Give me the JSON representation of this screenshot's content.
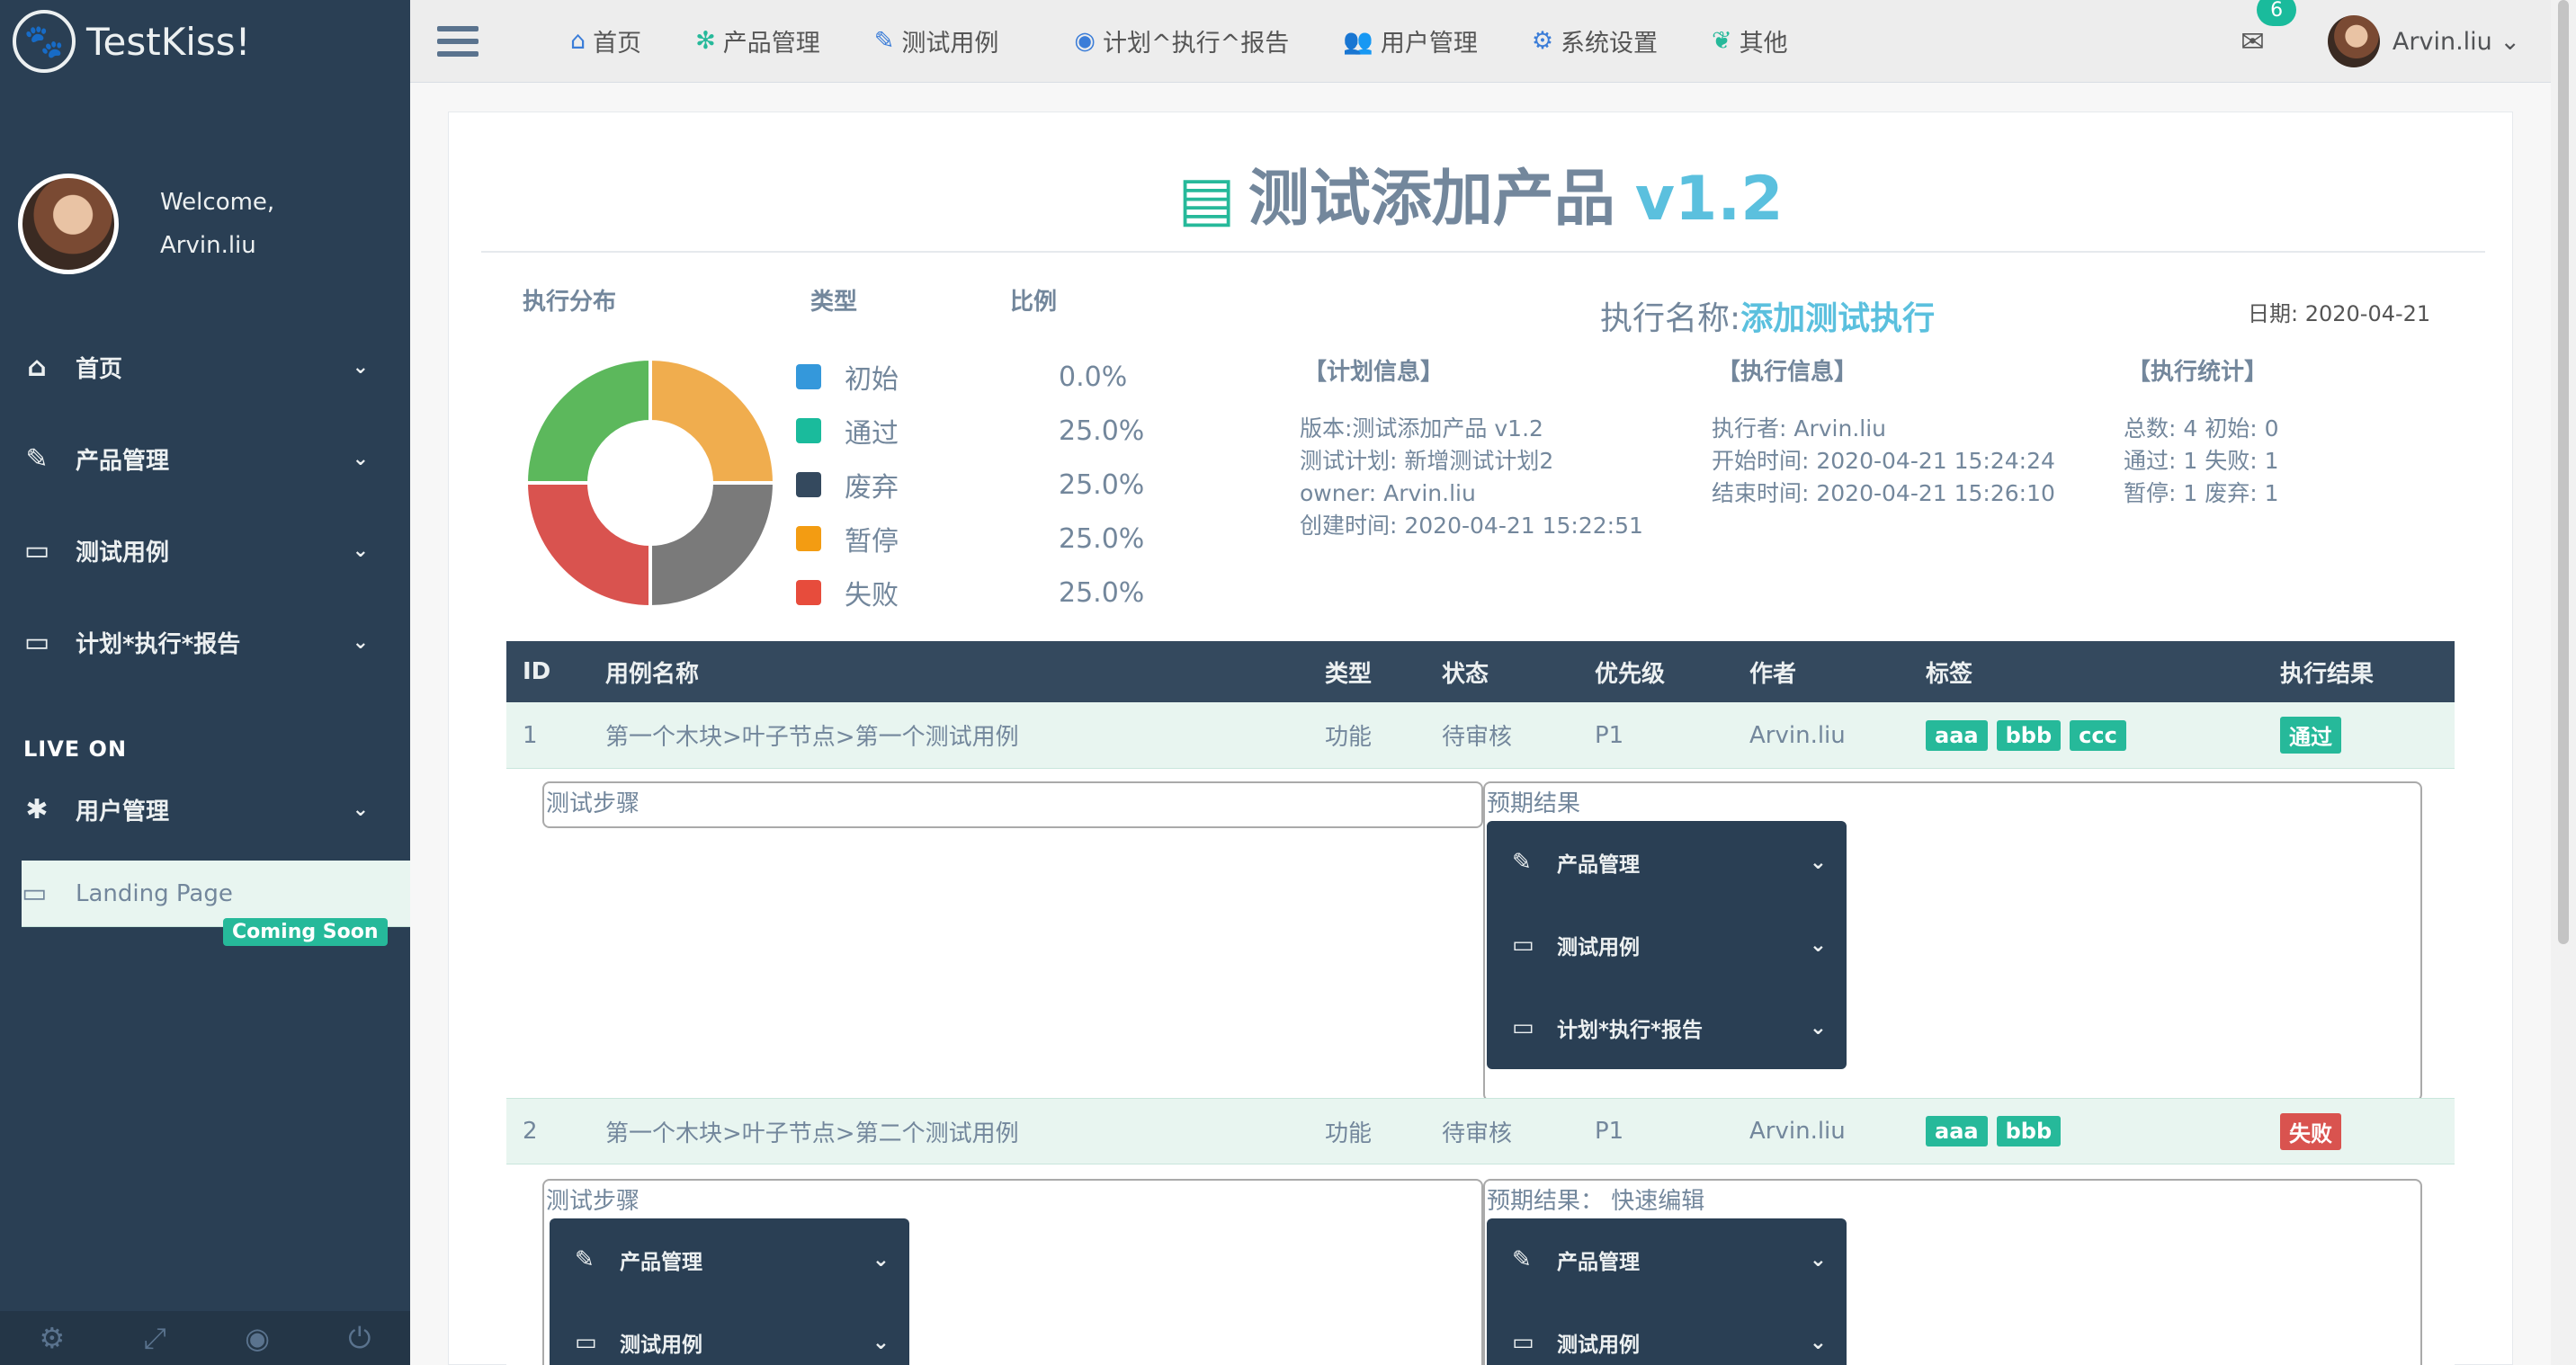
{
  "brand": {
    "name": "TestKiss!"
  },
  "profile": {
    "welcome": "Welcome,",
    "name": "Arvin.liu"
  },
  "sidebar": {
    "items": [
      {
        "label": "首页",
        "icon": "home-icon"
      },
      {
        "label": "产品管理",
        "icon": "edit-icon"
      },
      {
        "label": "测试用例",
        "icon": "desktop-icon"
      },
      {
        "label": "计划*执行*报告",
        "icon": "desktop-icon"
      }
    ],
    "section_title": "LIVE ON",
    "live_items": [
      {
        "label": "用户管理",
        "icon": "bug-icon"
      }
    ],
    "landing": {
      "label": "Landing Page",
      "badge": "Coming Soon"
    }
  },
  "topnav": {
    "links": [
      {
        "label": "首页",
        "icon": "home-icon"
      },
      {
        "label": "产品管理",
        "icon": "snowflake-icon"
      },
      {
        "label": "测试用例",
        "icon": "edit-icon"
      },
      {
        "label": "计划^执行^报告",
        "icon": "play-circle-icon"
      },
      {
        "label": "用户管理",
        "icon": "users-icon"
      },
      {
        "label": "系统设置",
        "icon": "cogs-icon"
      },
      {
        "label": "其他",
        "icon": "leaf-icon"
      }
    ],
    "mail_count": "6",
    "user_name": "Arvin.liu"
  },
  "report": {
    "title": "测试添加产品",
    "version": "v1.2",
    "dist_headers": {
      "dist": "执行分布",
      "type": "类型",
      "ratio": "比例"
    },
    "legend": [
      {
        "label": "初始",
        "value": "0.0%",
        "color": "#3498db"
      },
      {
        "label": "通过",
        "value": "25.0%",
        "color": "#1abb9c"
      },
      {
        "label": "废弃",
        "value": "25.0%",
        "color": "#34495e"
      },
      {
        "label": "暂停",
        "value": "25.0%",
        "color": "#f39c12"
      },
      {
        "label": "失败",
        "value": "25.0%",
        "color": "#e74c3c"
      }
    ],
    "exec_name_label": "执行名称:",
    "exec_name": "添加测试执行",
    "date": "日期: 2020-04-21",
    "plan_info": {
      "head": "【计划信息】",
      "lines": [
        "版本:测试添加产品 v1.2",
        "测试计划: 新增测试计划2",
        "owner: Arvin.liu",
        "创建时间: 2020-04-21 15:22:51"
      ]
    },
    "exec_info": {
      "head": "【执行信息】",
      "lines": [
        "执行者: Arvin.liu",
        "开始时间: 2020-04-21 15:24:24",
        "结束时间: 2020-04-21 15:26:10"
      ]
    },
    "exec_stats": {
      "head": "【执行统计】",
      "lines": [
        "总数: 4 初始: 0",
        "通过: 1 失败: 1",
        "暂停: 1 废弃: 1"
      ]
    }
  },
  "table": {
    "headers": [
      "ID",
      "用例名称",
      "类型",
      "状态",
      "优先级",
      "作者",
      "标签",
      "执行结果"
    ],
    "rows": [
      {
        "id": "1",
        "name": "第一个木块>叶子节点>第一个测试用例",
        "type": "功能",
        "status": "待审核",
        "priority": "P1",
        "author": "Arvin.liu",
        "tags": [
          "aaa",
          "bbb",
          "ccc"
        ],
        "result": "通过"
      },
      {
        "id": "2",
        "name": "第一个木块>叶子节点>第二个测试用例",
        "type": "功能",
        "status": "待审核",
        "priority": "P1",
        "author": "Arvin.liu",
        "tags": [
          "aaa",
          "bbb"
        ],
        "result": "失败"
      }
    ],
    "detail": {
      "steps_label": "测试步骤",
      "expected_label": "预期结果",
      "expected_label_edit": "预期结果： 快速编辑"
    },
    "submenu": [
      {
        "label": "产品管理"
      },
      {
        "label": "测试用例"
      },
      {
        "label": "计划*执行*报告"
      }
    ]
  },
  "chart_data": {
    "type": "pie",
    "categories": [
      "初始",
      "通过",
      "废弃",
      "暂停",
      "失败"
    ],
    "values": [
      0,
      25,
      25,
      25,
      25
    ],
    "slice_colors": [
      "#3498db",
      "#5cb85c",
      "#7a7a7a",
      "#f0ad4e",
      "#d9534f"
    ]
  }
}
